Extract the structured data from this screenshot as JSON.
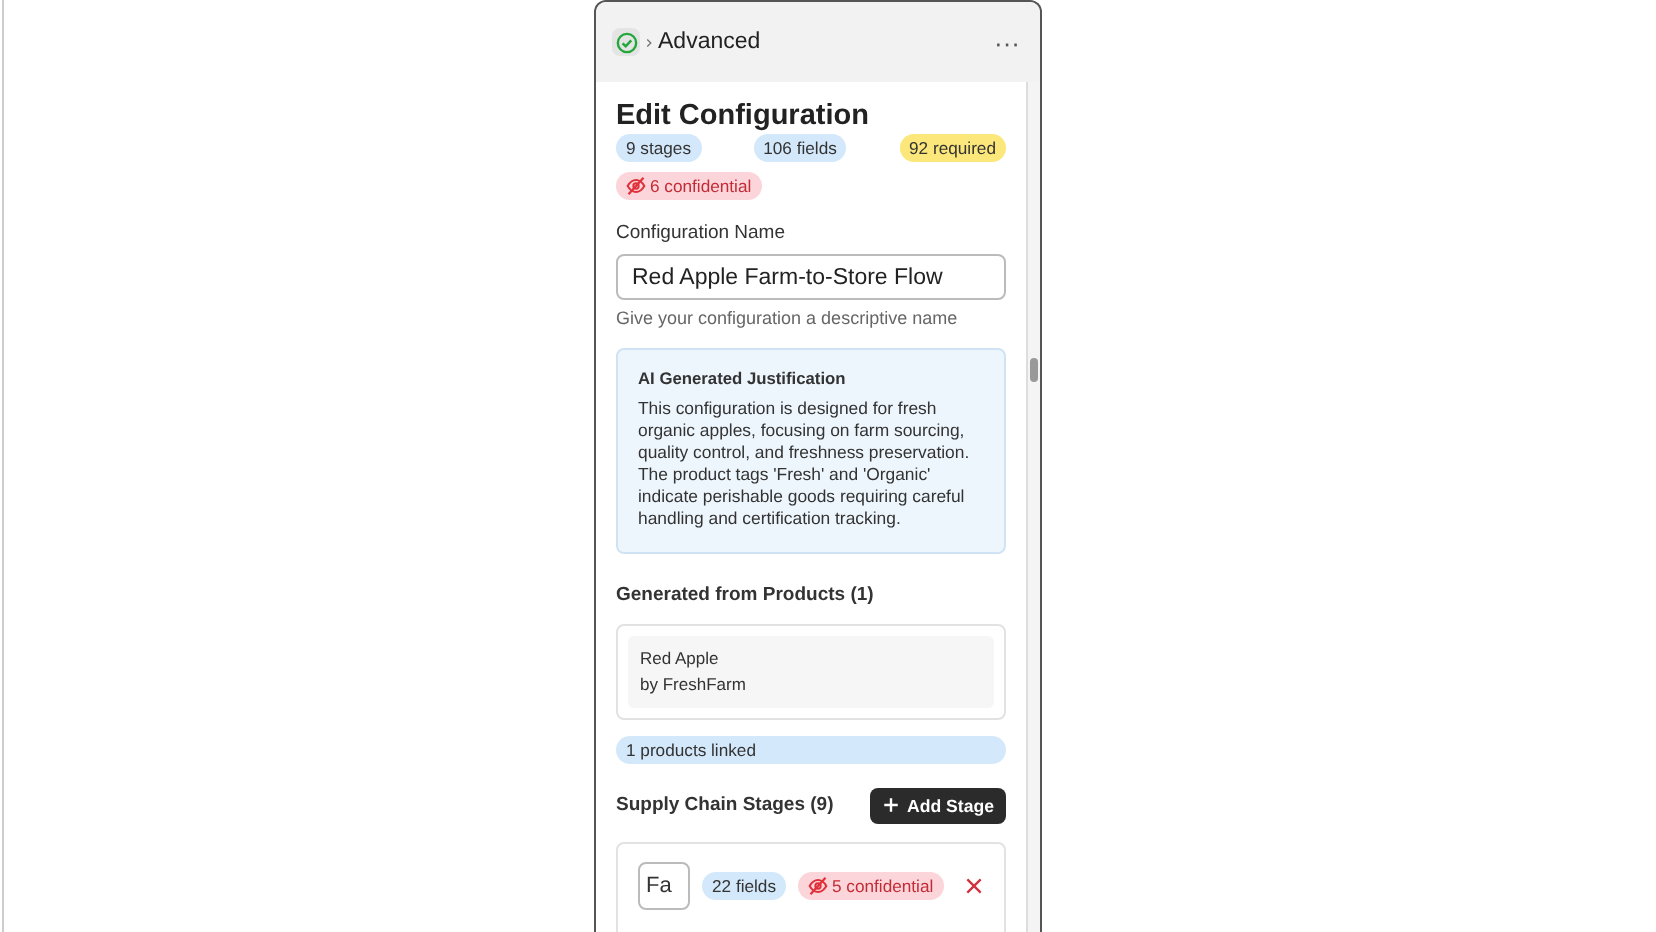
{
  "header": {
    "done": true,
    "title": "Advanced",
    "menu": "···"
  },
  "heading": "Edit Configuration",
  "badges": [
    {
      "label": "9 stages",
      "kind": "info"
    },
    {
      "label": "106 fields",
      "kind": "info"
    },
    {
      "label": "92 required",
      "kind": "warn"
    },
    {
      "label": "6 confidential",
      "kind": "secret"
    }
  ],
  "name_field": {
    "label": "Configuration Name",
    "value": "Red Apple Farm-to-Store Flow",
    "hint": "Give your configuration a descriptive name"
  },
  "justification": {
    "title": "AI Generated Justification",
    "text": "This configuration is designed for fresh organic apples, focusing on farm sourcing, quality control, and freshness preservation. The product tags 'Fresh' and 'Organic' indicate perishable goods requiring careful handling and certification tracking."
  },
  "products": {
    "title": "Generated from Products (1)",
    "items": [
      {
        "name": "Red Apple",
        "vendor": "by FreshFarm"
      }
    ],
    "linked": "1 products linked"
  },
  "stages": {
    "title": "Supply Chain Stages (9)",
    "add_button": "Add Stage",
    "items": [
      {
        "value": "Fa",
        "fields": "22 fields",
        "confidential": "5 confidential"
      }
    ]
  }
}
